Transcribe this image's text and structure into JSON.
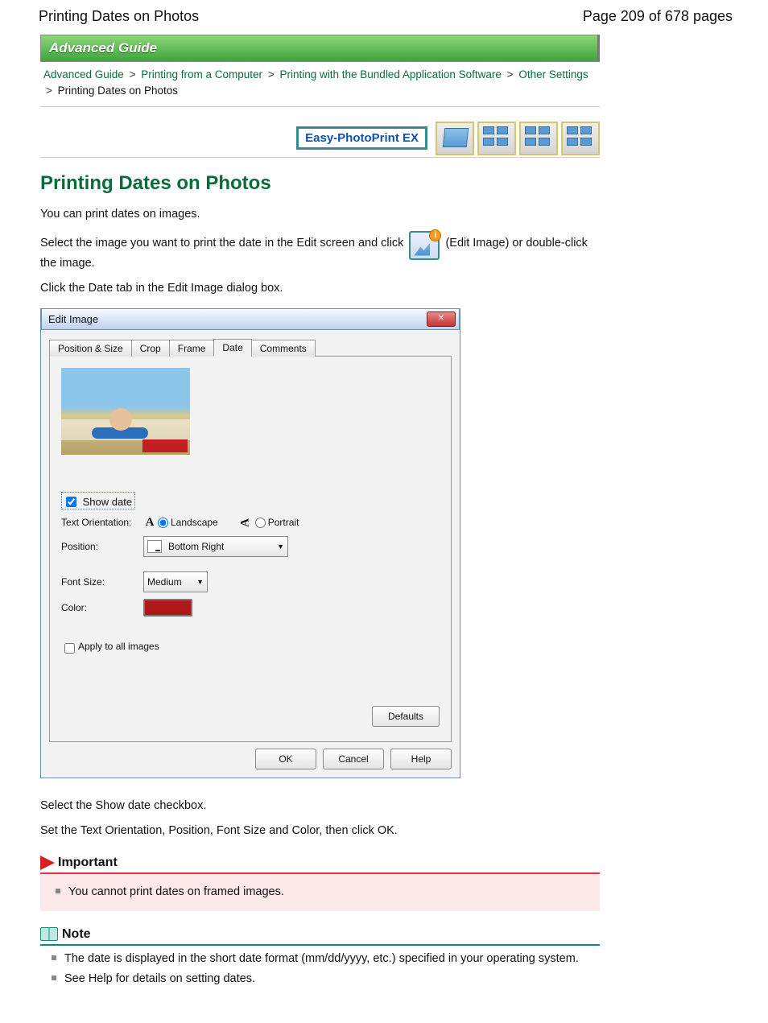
{
  "page": {
    "header_left": "Printing Dates on Photos",
    "header_right": "Page 209 of 678 pages"
  },
  "banner": {
    "title": "Advanced Guide"
  },
  "breadcrumb": {
    "items": [
      "Advanced Guide",
      "Printing from a Computer",
      "Printing with the Bundled Application Software",
      "Other Settings",
      "Printing Dates on Photos"
    ],
    "sep": ">"
  },
  "icons": {
    "app_badge": "Easy-PhotoPrint EX"
  },
  "main": {
    "title": "Printing Dates on Photos",
    "intro": "You can print dates on images.",
    "para1_a": "Select the image you want to print the date in the Edit screen and click ",
    "para1_b": " (Edit Image) or double-click the image.",
    "para2": "Click the Date tab in the Edit Image dialog box.",
    "after1": "Select the Show date checkbox.",
    "after2": "Set the Text Orientation, Position, Font Size and Color, then click OK."
  },
  "dialog": {
    "title": "Edit Image",
    "close_glyph": "✕",
    "tabs": [
      "Position & Size",
      "Crop",
      "Frame",
      "Date",
      "Comments"
    ],
    "active_tab": 3,
    "show_date_label": "Show date",
    "show_date_checked": true,
    "orientation_label": "Text Orientation:",
    "orientation_landscape": "Landscape",
    "orientation_portrait": "Portrait",
    "orientation_selected": "landscape",
    "position_label": "Position:",
    "position_value": "Bottom Right",
    "font_size_label": "Font Size:",
    "font_size_value": "Medium",
    "color_label": "Color:",
    "color_value": "#b01818",
    "apply_all_label": "Apply to all images",
    "apply_all_checked": false,
    "defaults_btn": "Defaults",
    "ok_btn": "OK",
    "cancel_btn": "Cancel",
    "help_btn": "Help"
  },
  "important": {
    "heading": "Important",
    "items": [
      "You cannot print dates on framed images."
    ]
  },
  "note": {
    "heading": "Note",
    "items": [
      "The date is displayed in the short date format (mm/dd/yyyy, etc.) specified in your operating system.",
      "See Help for details on setting dates."
    ]
  }
}
